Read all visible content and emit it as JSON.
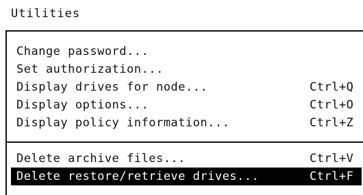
{
  "menu": {
    "title": "Utilities",
    "group1": [
      {
        "label": "Change password...",
        "shortcut": ""
      },
      {
        "label": "Set authorization...",
        "shortcut": ""
      },
      {
        "label": "Display drives for node...",
        "shortcut": "Ctrl+Q"
      },
      {
        "label": "Display options...",
        "shortcut": "Ctrl+O"
      },
      {
        "label": "Display policy information...",
        "shortcut": "Ctrl+Z"
      }
    ],
    "group2": [
      {
        "label": "Delete archive files...",
        "shortcut": "Ctrl+V"
      },
      {
        "label": "Delete restore/retrieve drives...",
        "shortcut": "Ctrl+F",
        "selected": true
      }
    ]
  },
  "colors": {
    "background": "#ffffff",
    "text": "#111111",
    "highlight": "#000000",
    "highlight_text": "#ffffff"
  }
}
